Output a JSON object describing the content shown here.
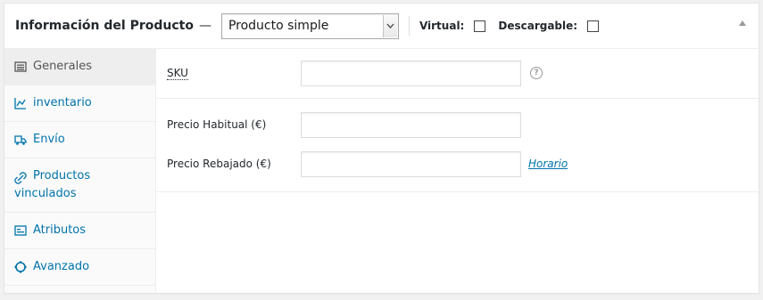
{
  "header": {
    "title": "Información del Producto",
    "separator": "—",
    "product_type": "Producto simple",
    "virtual_label": "Virtual:",
    "downloadable_label": "Descargable:"
  },
  "tabs": [
    {
      "label": "Generales",
      "icon": "list-icon"
    },
    {
      "label": "inventario",
      "icon": "chart-icon"
    },
    {
      "label": "Envío",
      "icon": "truck-icon"
    },
    {
      "label": "Productos vinculados",
      "icon": "link-icon"
    },
    {
      "label": "Atributos",
      "icon": "attributes-icon"
    },
    {
      "label": "Avanzado",
      "icon": "gear-icon"
    }
  ],
  "fields": {
    "sku_label": "SKU",
    "sku_value": "",
    "sku_help": "?",
    "regular_price_label": "Precio Habitual (€)",
    "regular_price_value": "",
    "sale_price_label": "Precio Rebajado (€)",
    "sale_price_value": "",
    "schedule_link": "Horario"
  },
  "colors": {
    "accent": "#0073aa",
    "active_tab_bg": "#eeeeee"
  }
}
